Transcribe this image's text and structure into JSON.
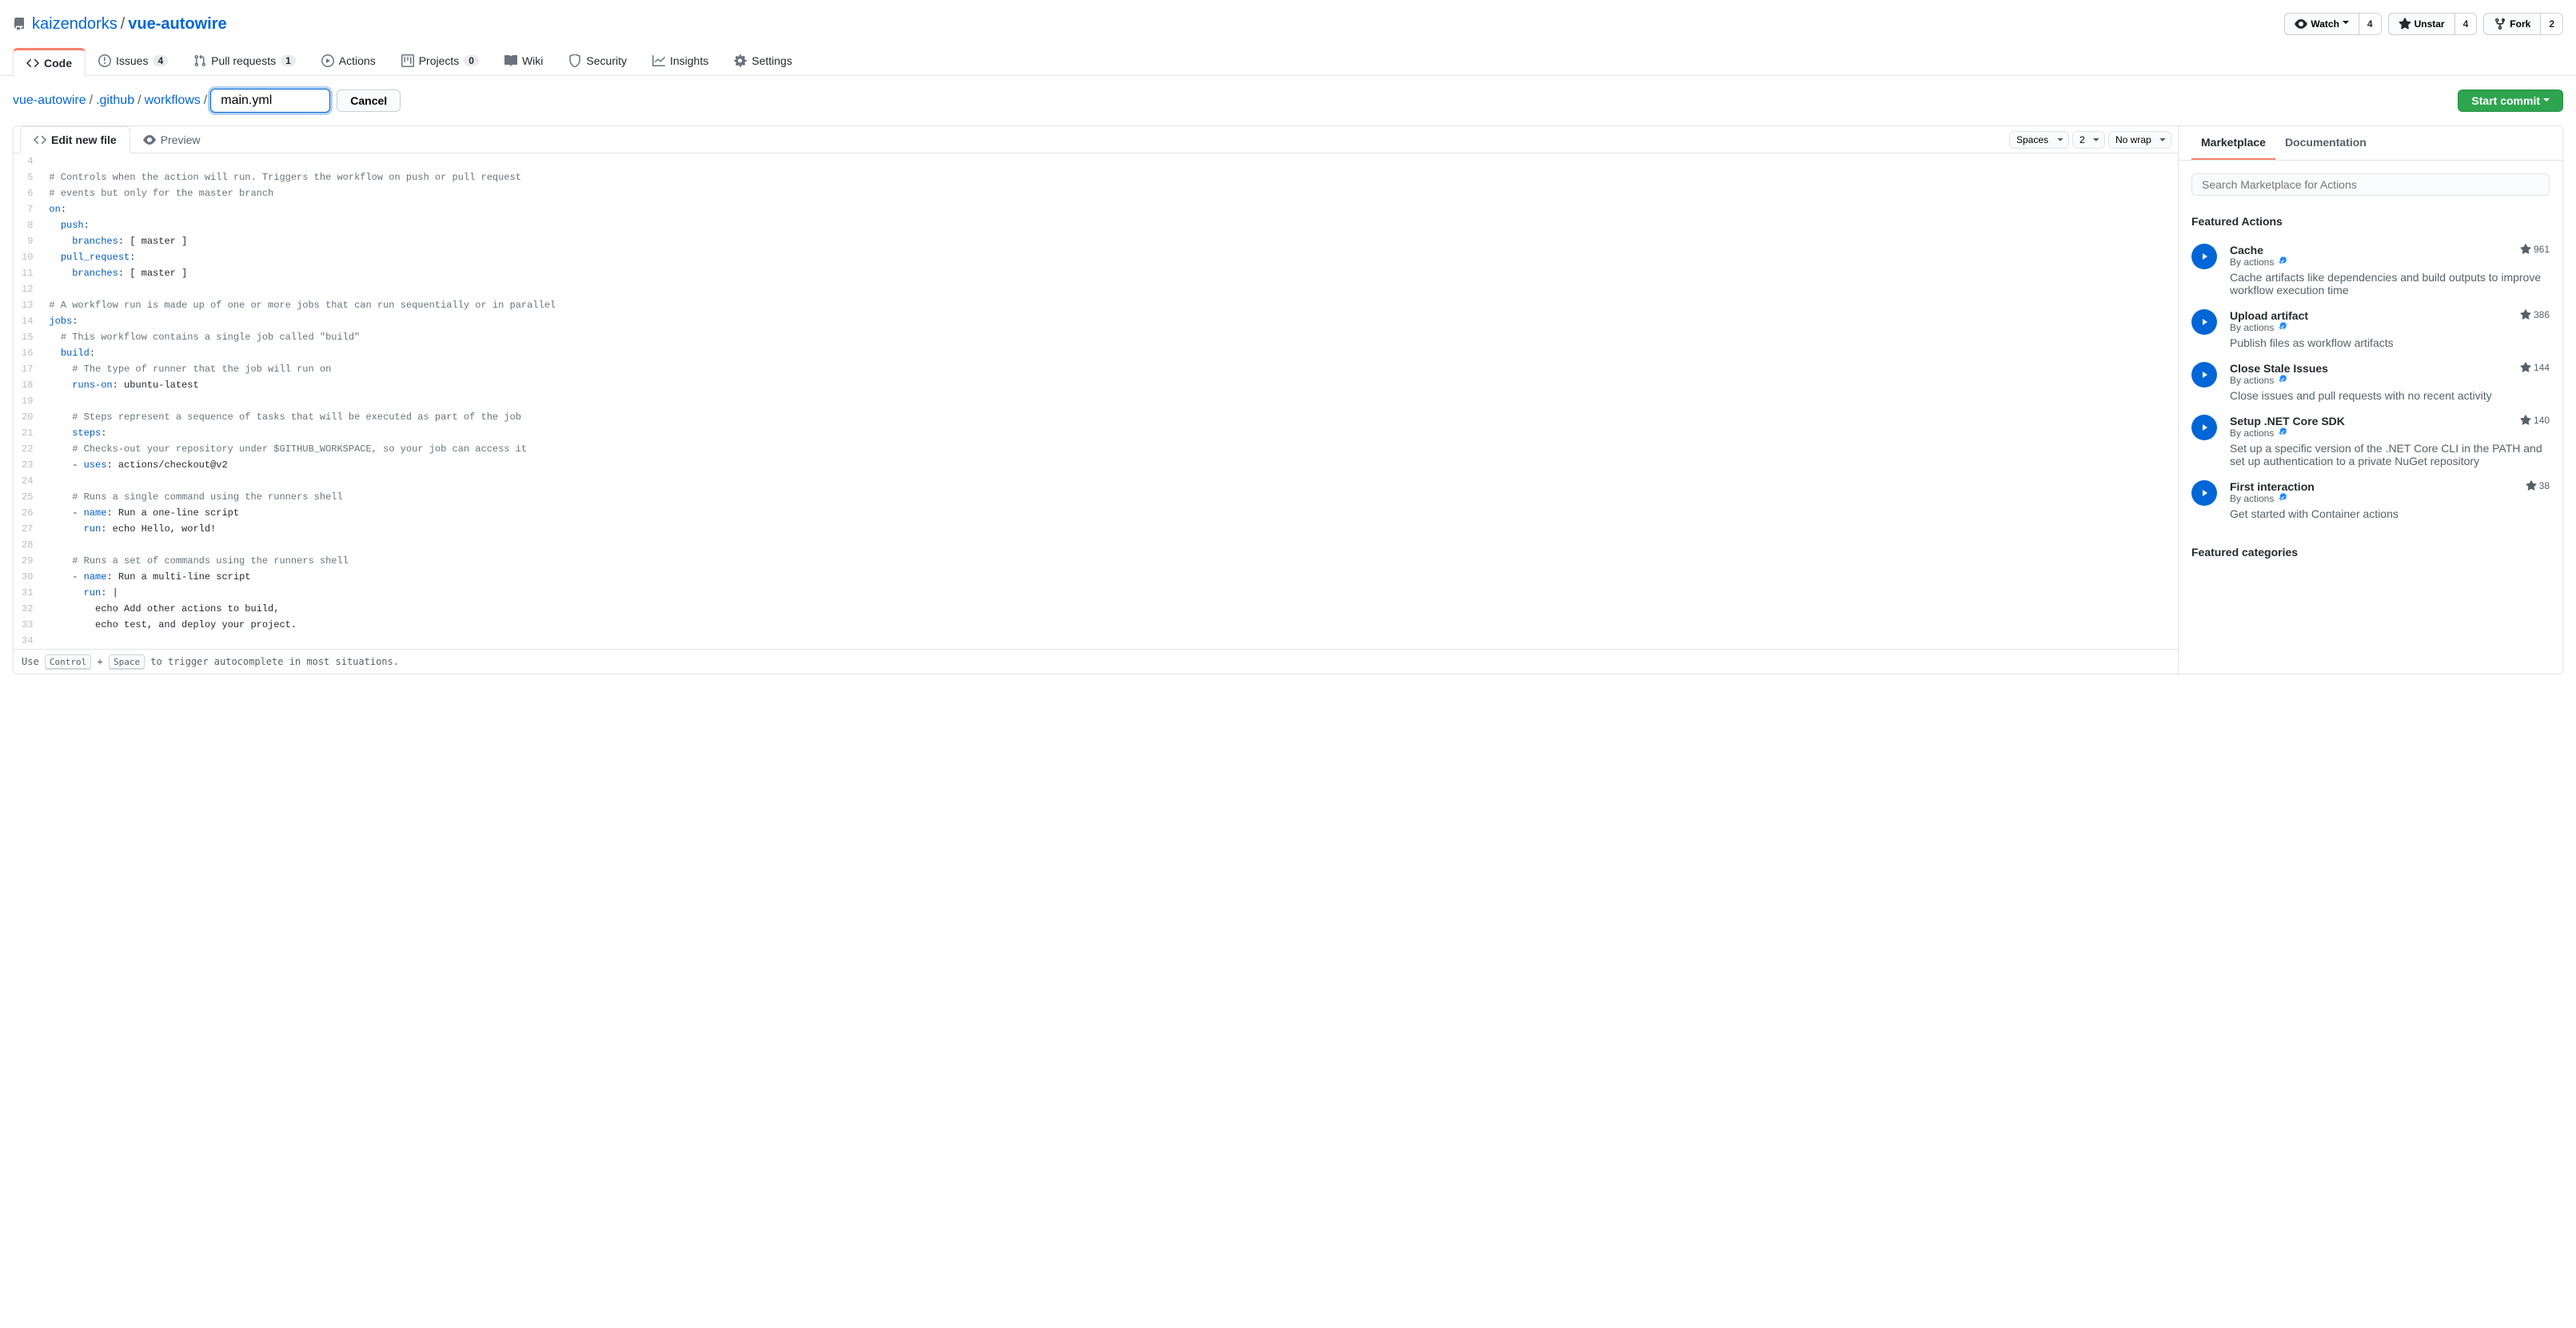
{
  "repo": {
    "owner": "kaizendorks",
    "name": "vue-autowire"
  },
  "repoActions": {
    "watch": {
      "label": "Watch",
      "count": "4"
    },
    "unstar": {
      "label": "Unstar",
      "count": "4"
    },
    "fork": {
      "label": "Fork",
      "count": "2"
    }
  },
  "tabs": {
    "code": "Code",
    "issues": {
      "label": "Issues",
      "count": "4"
    },
    "pulls": {
      "label": "Pull requests",
      "count": "1"
    },
    "actions": "Actions",
    "projects": {
      "label": "Projects",
      "count": "0"
    },
    "wiki": "Wiki",
    "security": "Security",
    "insights": "Insights",
    "settings": "Settings"
  },
  "breadcrumb": {
    "root": "vue-autowire",
    "p1": ".github",
    "p2": "workflows",
    "filename": "main.yml",
    "cancel": "Cancel",
    "commit": "Start commit"
  },
  "editorTabs": {
    "edit": "Edit new file",
    "preview": "Preview",
    "indent": "Spaces",
    "indentSize": "2",
    "wrap": "No wrap"
  },
  "codeLines": [
    {
      "n": 4,
      "segs": []
    },
    {
      "n": 5,
      "segs": [
        [
          "c",
          "# Controls when the action will run. Triggers the workflow on push or pull request"
        ]
      ]
    },
    {
      "n": 6,
      "segs": [
        [
          "c",
          "# events but only for the master branch"
        ]
      ]
    },
    {
      "n": 7,
      "segs": [
        [
          "k",
          "on"
        ],
        [
          "p",
          ":"
        ]
      ]
    },
    {
      "n": 8,
      "segs": [
        [
          "p",
          "  "
        ],
        [
          "k",
          "push"
        ],
        [
          "p",
          ":"
        ]
      ]
    },
    {
      "n": 9,
      "segs": [
        [
          "p",
          "    "
        ],
        [
          "k",
          "branches"
        ],
        [
          "p",
          ": [ master ]"
        ]
      ]
    },
    {
      "n": 10,
      "segs": [
        [
          "p",
          "  "
        ],
        [
          "k",
          "pull_request"
        ],
        [
          "p",
          ":"
        ]
      ]
    },
    {
      "n": 11,
      "segs": [
        [
          "p",
          "    "
        ],
        [
          "k",
          "branches"
        ],
        [
          "p",
          ": [ master ]"
        ]
      ]
    },
    {
      "n": 12,
      "segs": []
    },
    {
      "n": 13,
      "segs": [
        [
          "c",
          "# A workflow run is made up of one or more jobs that can run sequentially or in parallel"
        ]
      ]
    },
    {
      "n": 14,
      "segs": [
        [
          "k",
          "jobs"
        ],
        [
          "p",
          ":"
        ]
      ]
    },
    {
      "n": 15,
      "segs": [
        [
          "p",
          "  "
        ],
        [
          "c",
          "# This workflow contains a single job called \"build\""
        ]
      ]
    },
    {
      "n": 16,
      "segs": [
        [
          "p",
          "  "
        ],
        [
          "k",
          "build"
        ],
        [
          "p",
          ":"
        ]
      ]
    },
    {
      "n": 17,
      "segs": [
        [
          "p",
          "    "
        ],
        [
          "c",
          "# The type of runner that the job will run on"
        ]
      ]
    },
    {
      "n": 18,
      "segs": [
        [
          "p",
          "    "
        ],
        [
          "k",
          "runs-on"
        ],
        [
          "p",
          ": ubuntu-latest"
        ]
      ]
    },
    {
      "n": 19,
      "segs": []
    },
    {
      "n": 20,
      "segs": [
        [
          "p",
          "    "
        ],
        [
          "c",
          "# Steps represent a sequence of tasks that will be executed as part of the job"
        ]
      ]
    },
    {
      "n": 21,
      "segs": [
        [
          "p",
          "    "
        ],
        [
          "k",
          "steps"
        ],
        [
          "p",
          ":"
        ]
      ]
    },
    {
      "n": 22,
      "segs": [
        [
          "p",
          "    "
        ],
        [
          "c",
          "# Checks-out your repository under $GITHUB_WORKSPACE, so your job can access it"
        ]
      ]
    },
    {
      "n": 23,
      "segs": [
        [
          "p",
          "    - "
        ],
        [
          "k",
          "uses"
        ],
        [
          "p",
          ": actions/checkout@v2"
        ]
      ]
    },
    {
      "n": 24,
      "segs": []
    },
    {
      "n": 25,
      "segs": [
        [
          "p",
          "    "
        ],
        [
          "c",
          "# Runs a single command using the runners shell"
        ]
      ]
    },
    {
      "n": 26,
      "segs": [
        [
          "p",
          "    - "
        ],
        [
          "k",
          "name"
        ],
        [
          "p",
          ": Run a one-line script"
        ]
      ]
    },
    {
      "n": 27,
      "segs": [
        [
          "p",
          "      "
        ],
        [
          "k",
          "run"
        ],
        [
          "p",
          ": echo Hello, world!"
        ]
      ]
    },
    {
      "n": 28,
      "segs": []
    },
    {
      "n": 29,
      "segs": [
        [
          "p",
          "    "
        ],
        [
          "c",
          "# Runs a set of commands using the runners shell"
        ]
      ]
    },
    {
      "n": 30,
      "segs": [
        [
          "p",
          "    - "
        ],
        [
          "k",
          "name"
        ],
        [
          "p",
          ": Run a multi-line script"
        ]
      ]
    },
    {
      "n": 31,
      "segs": [
        [
          "p",
          "      "
        ],
        [
          "k",
          "run"
        ],
        [
          "p",
          ": |"
        ]
      ]
    },
    {
      "n": 32,
      "segs": [
        [
          "p",
          "        echo Add other actions to build,"
        ]
      ]
    },
    {
      "n": 33,
      "segs": [
        [
          "p",
          "        echo test, and deploy your project."
        ]
      ]
    },
    {
      "n": 34,
      "segs": []
    }
  ],
  "editorFooter": {
    "pre": "Use ",
    "k1": "Control",
    "plus": " + ",
    "k2": "Space",
    "post": " to trigger autocomplete in most situations."
  },
  "sidebar": {
    "tabMarket": "Marketplace",
    "tabDocs": "Documentation",
    "searchPlaceholder": "Search Marketplace for Actions",
    "featured": "Featured Actions",
    "byPrefix": "By ",
    "actions": [
      {
        "title": "Cache",
        "by": "actions",
        "stars": "961",
        "desc": "Cache artifacts like dependencies and build outputs to improve workflow execution time"
      },
      {
        "title": "Upload artifact",
        "by": "actions",
        "stars": "386",
        "desc": "Publish files as workflow artifacts"
      },
      {
        "title": "Close Stale Issues",
        "by": "actions",
        "stars": "144",
        "desc": "Close issues and pull requests with no recent activity"
      },
      {
        "title": "Setup .NET Core SDK",
        "by": "actions",
        "stars": "140",
        "desc": "Set up a specific version of the .NET Core CLI in the PATH and set up authentication to a private NuGet repository"
      },
      {
        "title": "First interaction",
        "by": "actions",
        "stars": "38",
        "desc": "Get started with Container actions"
      }
    ],
    "categories": "Featured categories"
  }
}
